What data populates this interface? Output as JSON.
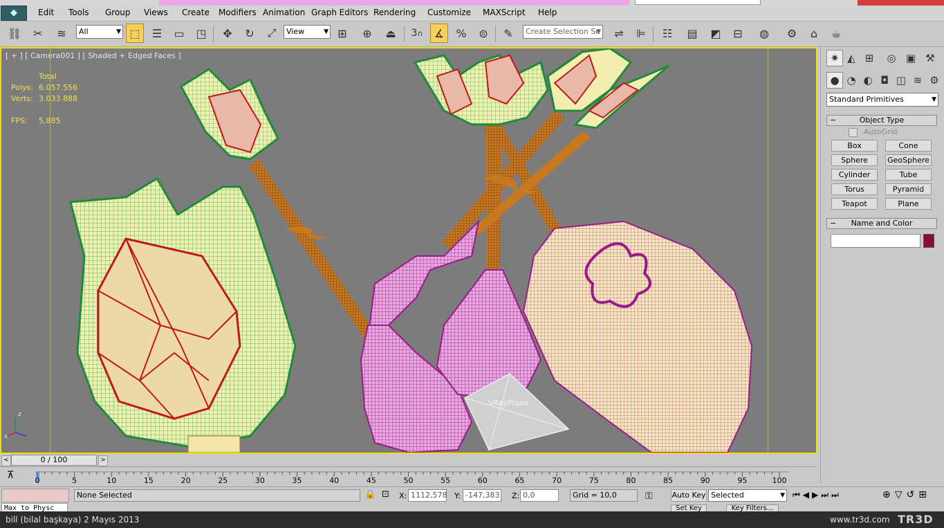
{
  "menu": {
    "items": [
      "Edit",
      "Tools",
      "Group",
      "Views",
      "Create",
      "Modifiers",
      "Animation",
      "Graph Editors",
      "Rendering",
      "Customize",
      "MAXScript",
      "Help"
    ]
  },
  "toolbar": {
    "filter_value": "All",
    "reference_coord_value": "View",
    "selection_set_placeholder": "Create Selection Se",
    "snap_label": "3",
    "angle_snap_label": "%"
  },
  "viewport": {
    "label": "[ + ] [ Camera001 ] [ Shaded + Edged Faces ]",
    "stats": {
      "total_label": "Total",
      "polys_label": "Polys:",
      "polys_value": "6.057.556",
      "verts_label": "Verts:",
      "verts_value": "3.033.888",
      "fps_label": "FPS:",
      "fps_value": "5,885"
    },
    "object_label": "VRayPlane",
    "axis": {
      "z": "z",
      "x": "x"
    }
  },
  "command_panel": {
    "category_dropdown": "Standard Primitives",
    "object_type": {
      "title": "Object Type",
      "autogrid": "AutoGrid",
      "buttons": [
        "Box",
        "Cone",
        "Sphere",
        "GeoSphere",
        "Cylinder",
        "Tube",
        "Torus",
        "Pyramid",
        "Teapot",
        "Plane"
      ]
    },
    "name_color": {
      "title": "Name and Color",
      "name_value": "",
      "color": "#8b0a3c"
    }
  },
  "timeline": {
    "slider_label": "0 / 100",
    "ticks": [
      "0",
      "5",
      "10",
      "15",
      "20",
      "25",
      "30",
      "35",
      "40",
      "45",
      "50",
      "55",
      "60",
      "65",
      "70",
      "75",
      "80",
      "85",
      "90",
      "95",
      "100"
    ]
  },
  "status": {
    "listener_text": "Max to Physc",
    "selection_text": "None Selected",
    "x_label": "X:",
    "x_value": "1112,578",
    "y_label": "Y:",
    "y_value": "-147,383",
    "z_label": "Z:",
    "z_value": "0,0",
    "grid_text": "Grid = 10,0",
    "autokey_label": "Auto Key",
    "selected_dropdown": "Selected",
    "setkey_label": "Set Key",
    "keyfilters_label": "Key Filters..."
  },
  "footer": {
    "left_text": "bill (bilal başkaya)  2 Mayıs 2013",
    "right_text": "www.tr3d.com",
    "logo_text": "TR3D"
  },
  "colors": {
    "viewport_border": "#f0e000",
    "stats": "#f0e050",
    "tulip_green": "#1f8a3a",
    "tulip_fill": "#f3efb0",
    "stem_orange": "#b0601a",
    "pear_magenta": "#9a1a8a",
    "wire_red": "#c01818"
  }
}
